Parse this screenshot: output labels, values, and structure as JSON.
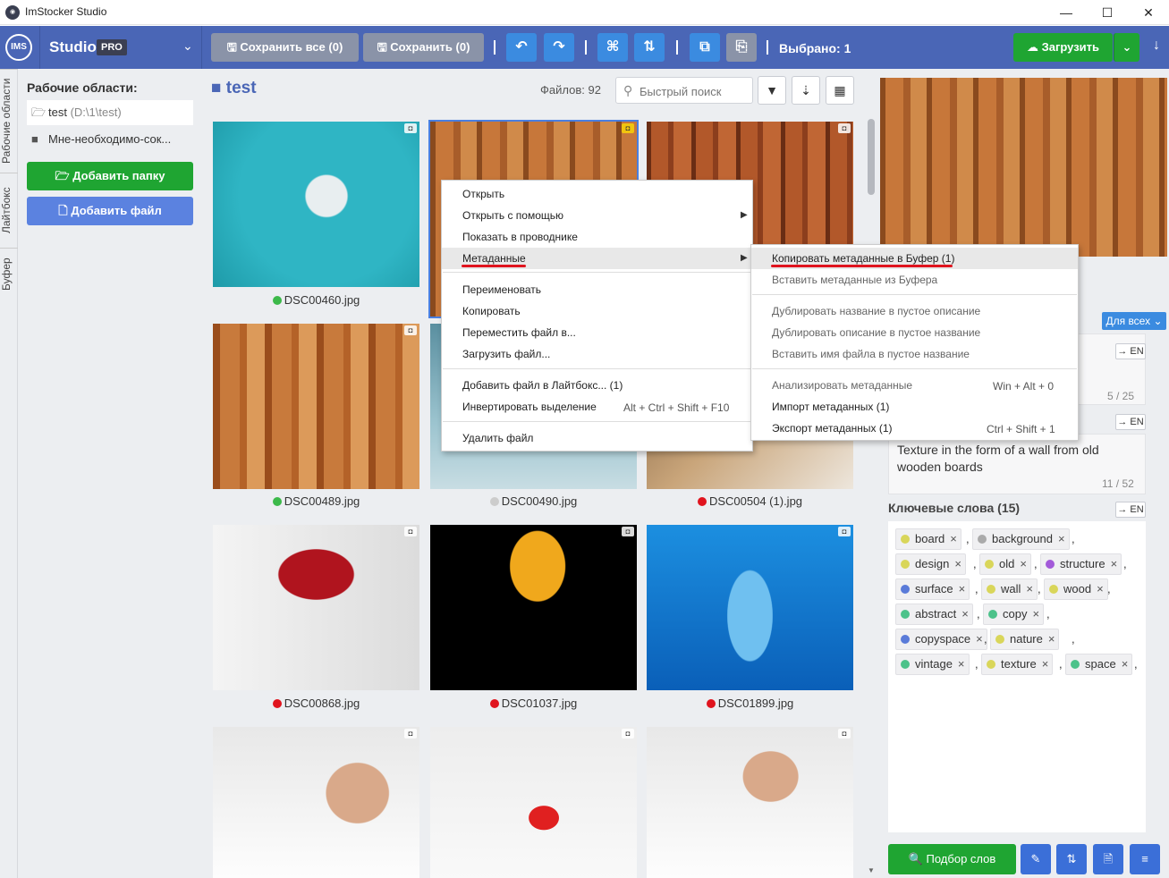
{
  "window": {
    "title": "ImStocker Studio",
    "icon": "app-logo-icon"
  },
  "brand": {
    "logo": "IMS",
    "name": "Studio",
    "badge": "PRO"
  },
  "toolbar": {
    "save_all": "Сохранить все (0)",
    "save": "Сохранить (0)",
    "selected": "Выбрано: 1",
    "upload": "Загрузить"
  },
  "vertical_tabs": [
    "Рабочие области",
    "Лайтбокс",
    "Буфер"
  ],
  "sidebar": {
    "workspaces_title": "Рабочие области:",
    "workspaces": [
      {
        "name": "test",
        "path": "(D:\\1\\test)"
      },
      {
        "name": "Мне-необходимо-сок...",
        "path": ""
      }
    ],
    "add_folder": "Добавить папку",
    "add_file": "Добавить файл"
  },
  "main": {
    "folder": "test",
    "files_count": "Файлов: 92",
    "search_placeholder": "Быстрый поиск"
  },
  "files": [
    {
      "name": "DSC00460.jpg",
      "status": "#3cb94a"
    },
    {
      "name": "",
      "status": ""
    },
    {
      "name": "",
      "status": ""
    },
    {
      "name": "DSC00489.jpg",
      "status": "#3cb94a"
    },
    {
      "name": "DSC00490.jpg",
      "status": "#cccccc"
    },
    {
      "name": "DSC00504 (1).jpg",
      "status": "#e0141e"
    },
    {
      "name": "DSC00868.jpg",
      "status": "#e0141e"
    },
    {
      "name": "DSC01037.jpg",
      "status": "#e0141e"
    },
    {
      "name": "DSC01899.jpg",
      "status": "#e0141e"
    }
  ],
  "context_menu": {
    "items": [
      "Открыть",
      "Открыть с помощью",
      "Показать в проводнике",
      "Метаданные",
      "Переименовать",
      "Копировать",
      "Переместить файл в...",
      "Загрузить файл...",
      "Добавить файл в Лайтбокс... (1)",
      "Инвертировать выделение",
      "Удалить файл"
    ],
    "invert_shortcut": "Alt + Ctrl + Shift + F10"
  },
  "submenu": {
    "items": [
      "Копировать метаданные в Буфер (1)",
      "Вставить метаданные из Буфера",
      "Дублировать название в пустое описание",
      "Дублировать описание в пустое название",
      "Вставить имя файла в пустое название",
      "Анализировать метаданные",
      "Импорт метаданных (1)",
      "Экспорт метаданных (1)"
    ],
    "analyze_shortcut": "Win + Alt + 0",
    "export_shortcut": "Ctrl + Shift + 1"
  },
  "details": {
    "for_all": "Для всех",
    "lang": "→ EN",
    "title_count": "5 / 25",
    "description": "Texture in the form of a wall from old wooden boards",
    "description_count": "11 / 52",
    "keywords_title": "Ключевые слова (15)",
    "keywords": [
      {
        "word": "board",
        "color": "#d9d65a"
      },
      {
        "word": "background",
        "color": "#aaaaaa"
      },
      {
        "word": "design",
        "color": "#d9d65a"
      },
      {
        "word": "old",
        "color": "#d9d65a"
      },
      {
        "word": "structure",
        "color": "#a35ad9"
      },
      {
        "word": "surface",
        "color": "#5a7bd9"
      },
      {
        "word": "wall",
        "color": "#d9d65a"
      },
      {
        "word": "wood",
        "color": "#d9d65a"
      },
      {
        "word": "abstract",
        "color": "#4cc28a"
      },
      {
        "word": "copy",
        "color": "#4cc28a"
      },
      {
        "word": "copyspace",
        "color": "#5a7bd9"
      },
      {
        "word": "nature",
        "color": "#d9d65a"
      },
      {
        "word": "vintage",
        "color": "#4cc28a"
      },
      {
        "word": "texture",
        "color": "#d9d65a"
      },
      {
        "word": "space",
        "color": "#4cc28a"
      }
    ],
    "pick_words": "Подбор слов"
  }
}
